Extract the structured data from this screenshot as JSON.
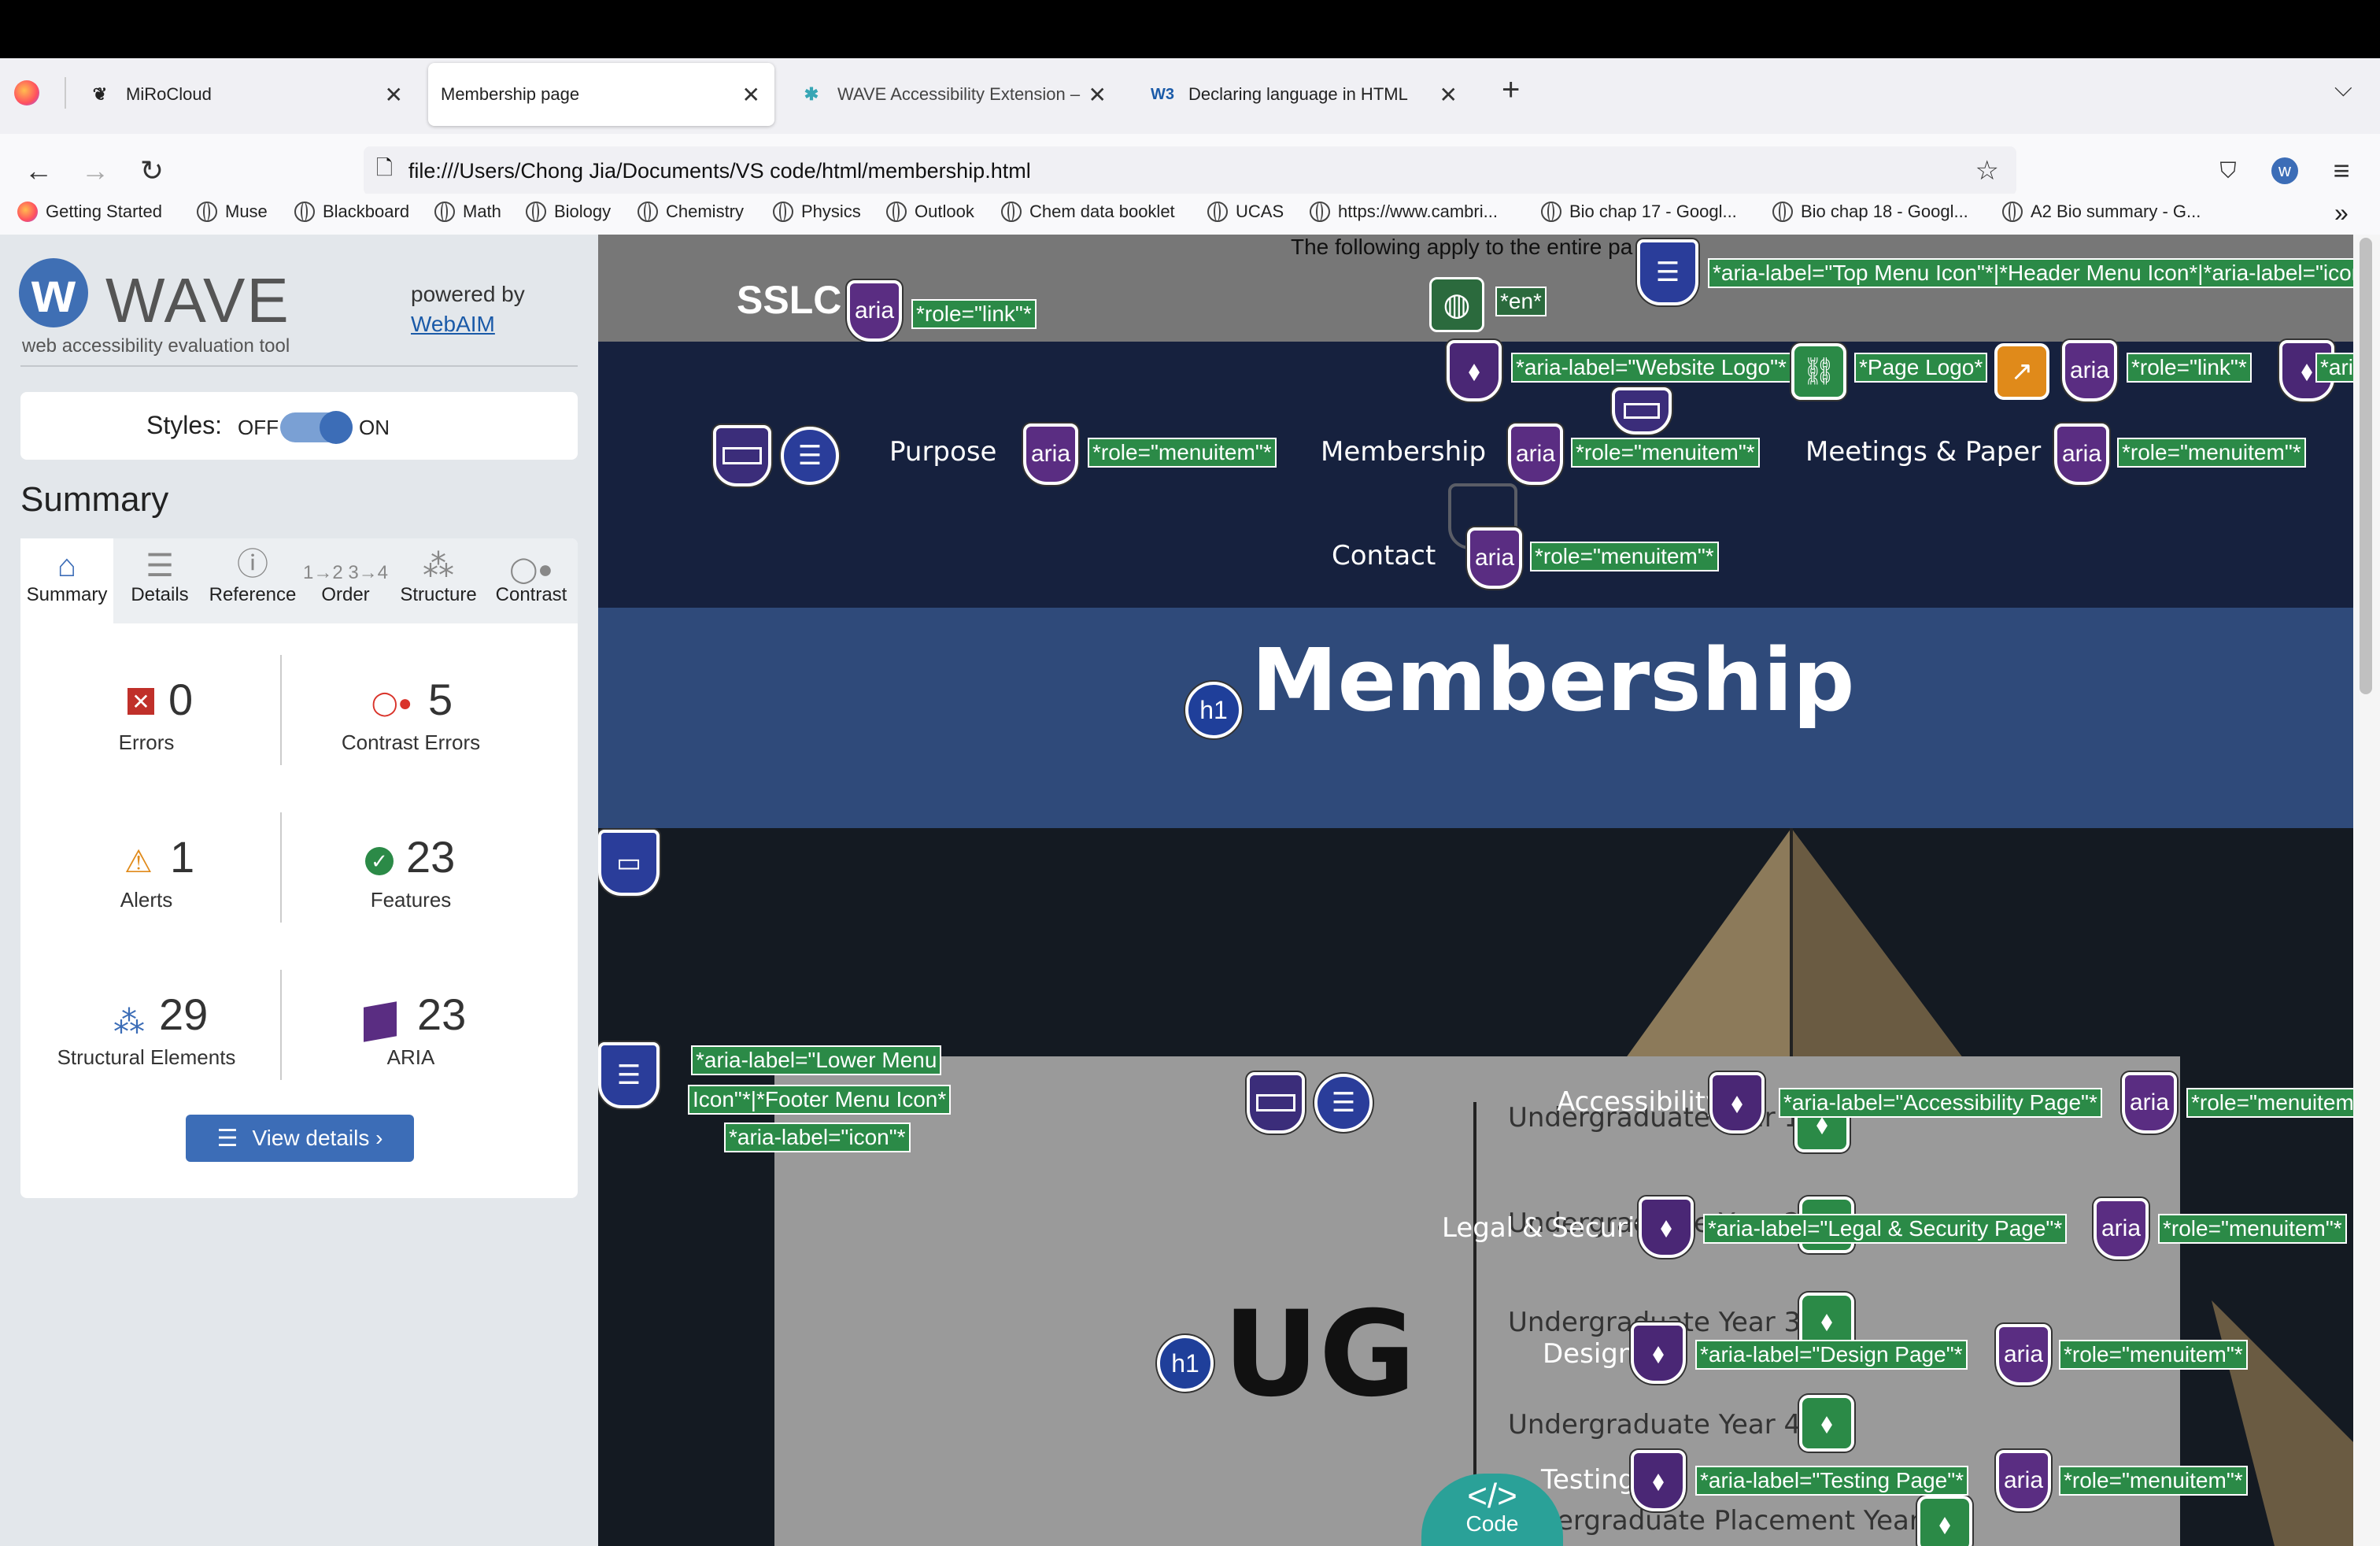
{
  "browser": {
    "tabs": [
      {
        "label": "MiRoCloud",
        "icon": "mirocloud-icon"
      },
      {
        "label": "Membership page",
        "icon": ""
      },
      {
        "label": "WAVE Accessibility Extension –",
        "icon": "wave-puzzle-icon"
      },
      {
        "label": "Declaring language in HTML",
        "icon": "w3-icon"
      }
    ],
    "url": "file:///Users/Chong Jia/Documents/VS code/html/membership.html",
    "bookmarks": [
      "Getting Started",
      "Muse",
      "Blackboard",
      "Math",
      "Biology",
      "Chemistry",
      "Physics",
      "Outlook",
      "Chem data booklet",
      "UCAS",
      "https://www.cambri...",
      "Bio chap 17 - Googl...",
      "Bio chap 18 - Googl...",
      "A2 Bio summary - G..."
    ]
  },
  "wave": {
    "title": "WAVE",
    "subtitle": "web accessibility evaluation tool",
    "powered_by": "powered by",
    "webaim": "WebAIM",
    "styles_label": "Styles:",
    "styles_off": "OFF",
    "styles_on": "ON",
    "summary_heading": "Summary",
    "tabs": [
      "Summary",
      "Details",
      "Reference",
      "Order",
      "Structure",
      "Contrast"
    ],
    "stats": {
      "errors": {
        "count": "0",
        "label": "Errors"
      },
      "contrast": {
        "count": "5",
        "label": "Contrast Errors"
      },
      "alerts": {
        "count": "1",
        "label": "Alerts"
      },
      "features": {
        "count": "23",
        "label": "Features"
      },
      "structural": {
        "count": "29",
        "label": "Structural Elements"
      },
      "aria": {
        "count": "23",
        "label": "ARIA"
      }
    },
    "view_details": "View details ›"
  },
  "page": {
    "top_note": "The following apply to the entire pa",
    "brand": "SSLC",
    "lang": "*en*",
    "nav": [
      "Purpose",
      "Membership",
      "Meetings & Paper",
      "Contact"
    ],
    "hero_title": "Membership",
    "ug_title": "UG",
    "ug_items": [
      "Undergraduate Year 1:",
      "Undergraduate Year 2:",
      "Undergraduate Year 3:",
      "Undergraduate Year 4:",
      "Undergraduate Placement Year:"
    ],
    "footer_links": [
      "Accessibility",
      "Legal & Security",
      "Design",
      "Testing"
    ],
    "labels": {
      "aria": "aria",
      "h1": "h1",
      "role_link": "*role=\"link\"*",
      "role_menuitem": "*role=\"menuitem\"*",
      "top_menu": "*aria-label=\"Top Menu Icon\"*|*Header Menu Icon*|*aria-label=\"icon",
      "website_logo": "*aria-label=\"Website Logo\"*",
      "page_logo": "*Page Logo*",
      "aria_trunc": "*aria",
      "lower_menu_1": "*aria-label=\"Lower Menu",
      "lower_menu_2": "Icon\"*|*Footer Menu Icon*",
      "lower_menu_3": "*aria-label=\"icon\"*",
      "accessibility_page": "*aria-label=\"Accessibility Page\"*",
      "legal_page": "*aria-label=\"Legal & Security Page\"*",
      "design_page": "*aria-label=\"Design Page\"*",
      "testing_page": "*aria-label=\"Testing Page\"*",
      "role_menuitem_trunc": "*role=\"menuitem"
    },
    "code_btn": "Code",
    "code_glyph": "</>"
  }
}
